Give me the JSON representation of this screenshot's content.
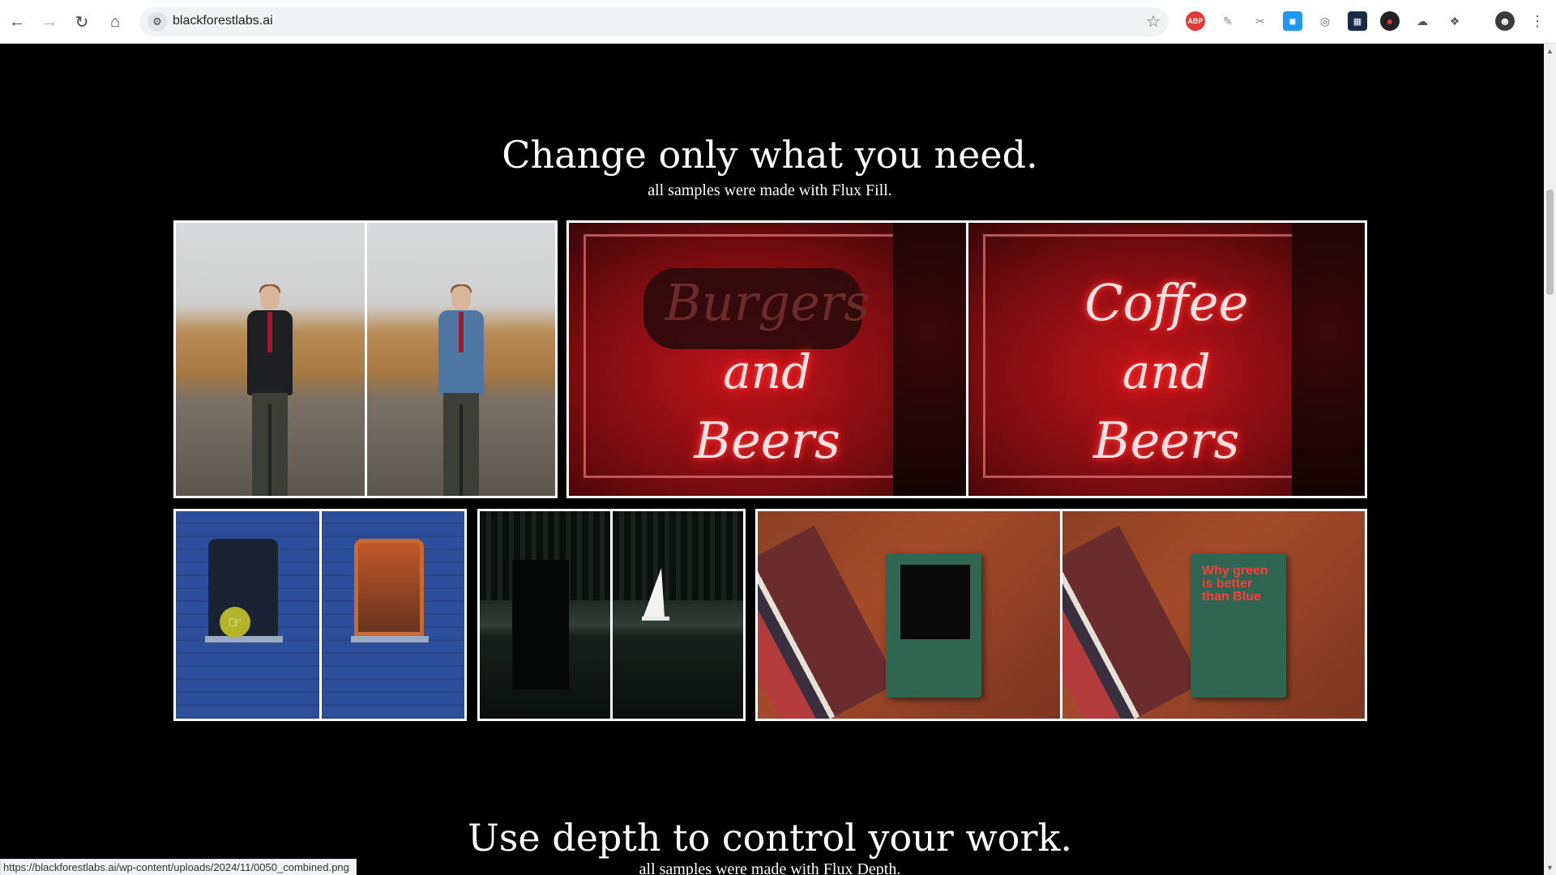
{
  "browser": {
    "url": "blackforestlabs.ai",
    "status_link": "https://blackforestlabs.ai/wp-content/uploads/2024/11/0050_combined.png"
  },
  "section_fill": {
    "title": "Change only what you need.",
    "subtitle": "all samples were made with Flux Fill."
  },
  "section_depth": {
    "title": "Use depth to control your work.",
    "subtitle": "all samples were made with Flux Depth."
  },
  "samples": {
    "neon_before": [
      "Burgers",
      "and",
      "Beers"
    ],
    "neon_after": [
      "Coffee",
      "and",
      "Beers"
    ],
    "book_after": "Why green is better than Blue"
  },
  "icons": {
    "back": "arrow-left-icon",
    "forward": "arrow-right-icon",
    "reload": "reload-icon",
    "home": "home-icon",
    "site_info": "tune-icon",
    "bookmark": "star-icon",
    "extensions": "puzzle-icon",
    "menu": "kebab-icon"
  },
  "colors": {
    "page_background": "#000000",
    "tile_border": "#ffffff",
    "neon_red": "#ff3b3b"
  }
}
